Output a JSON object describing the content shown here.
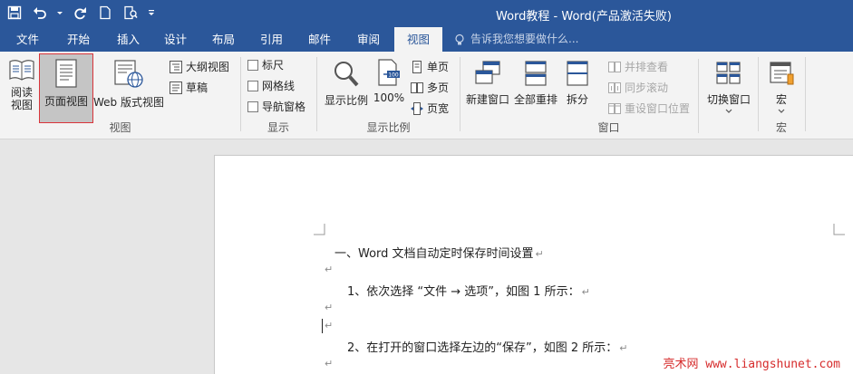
{
  "titlebar": {
    "title": "Word教程 - Word(产品激活失败)"
  },
  "tabs": [
    {
      "label": "文件"
    },
    {
      "label": "开始"
    },
    {
      "label": "插入"
    },
    {
      "label": "设计"
    },
    {
      "label": "布局"
    },
    {
      "label": "引用"
    },
    {
      "label": "邮件"
    },
    {
      "label": "审阅"
    },
    {
      "label": "视图"
    }
  ],
  "tellme": {
    "placeholder": "告诉我您想要做什么..."
  },
  "groups": {
    "views": {
      "label": "视图",
      "read_mode": "阅读\n视图",
      "print_layout": "页面视图",
      "web_layout": "Web 版式视图",
      "outline": "大纲视图",
      "draft": "草稿"
    },
    "show": {
      "label": "显示",
      "ruler": "标尺",
      "gridlines": "网格线",
      "nav_pane": "导航窗格"
    },
    "zoom": {
      "label": "显示比例",
      "zoom": "显示比例",
      "percent": "100%",
      "one_page": "单页",
      "multi_page": "多页",
      "page_width": "页宽"
    },
    "window": {
      "label": "窗口",
      "new_window": "新建窗口",
      "arrange_all": "全部重排",
      "split": "拆分",
      "side_by_side": "并排查看",
      "sync_scroll": "同步滚动",
      "reset_position": "重设窗口位置",
      "switch_windows": "切换窗口"
    },
    "macros": {
      "label": "宏",
      "macros": "宏"
    }
  },
  "document": {
    "lines": [
      "一、Word 文档自动定时保存时间设置",
      "",
      "1、依次选择 “文件 → 选项”，如图 1 所示：",
      "",
      "",
      "2、在打开的窗口选择左边的“保存”，如图 2 所示：",
      ""
    ],
    "para_mark": "↵"
  },
  "watermark": "亮术网 www.liangshunet.com"
}
